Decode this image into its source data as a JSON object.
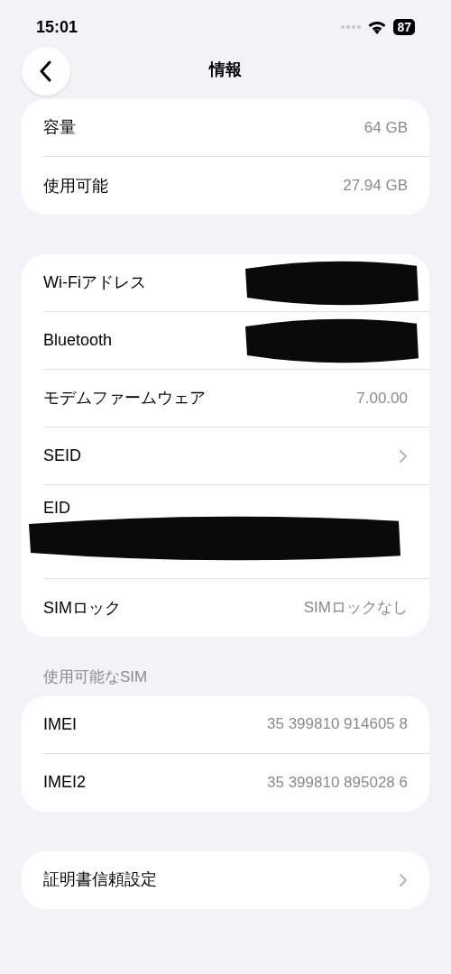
{
  "status_bar": {
    "time": "15:01",
    "battery": "87"
  },
  "nav": {
    "title": "情報"
  },
  "groups": [
    {
      "rows": [
        {
          "kind": "value",
          "label": "容量",
          "value": "64 GB"
        },
        {
          "kind": "value",
          "label": "使用可能",
          "value": "27.94 GB"
        }
      ]
    },
    {
      "rows": [
        {
          "kind": "redacted",
          "label": "Wi-Fiアドレス"
        },
        {
          "kind": "redacted",
          "label": "Bluetooth"
        },
        {
          "kind": "value",
          "label": "モデムファームウェア",
          "value": "7.00.00"
        },
        {
          "kind": "link",
          "label": "SEID"
        },
        {
          "kind": "redacted_below",
          "label": "EID"
        },
        {
          "kind": "value",
          "label": "SIMロック",
          "value": "SIMロックなし"
        }
      ]
    },
    {
      "header": "使用可能なSIM",
      "rows": [
        {
          "kind": "value",
          "label": "IMEI",
          "value": "35 399810 914605 8"
        },
        {
          "kind": "value",
          "label": "IMEI2",
          "value": "35 399810 895028 6"
        }
      ]
    },
    {
      "rows": [
        {
          "kind": "link",
          "label": "証明書信頼設定"
        }
      ]
    }
  ]
}
